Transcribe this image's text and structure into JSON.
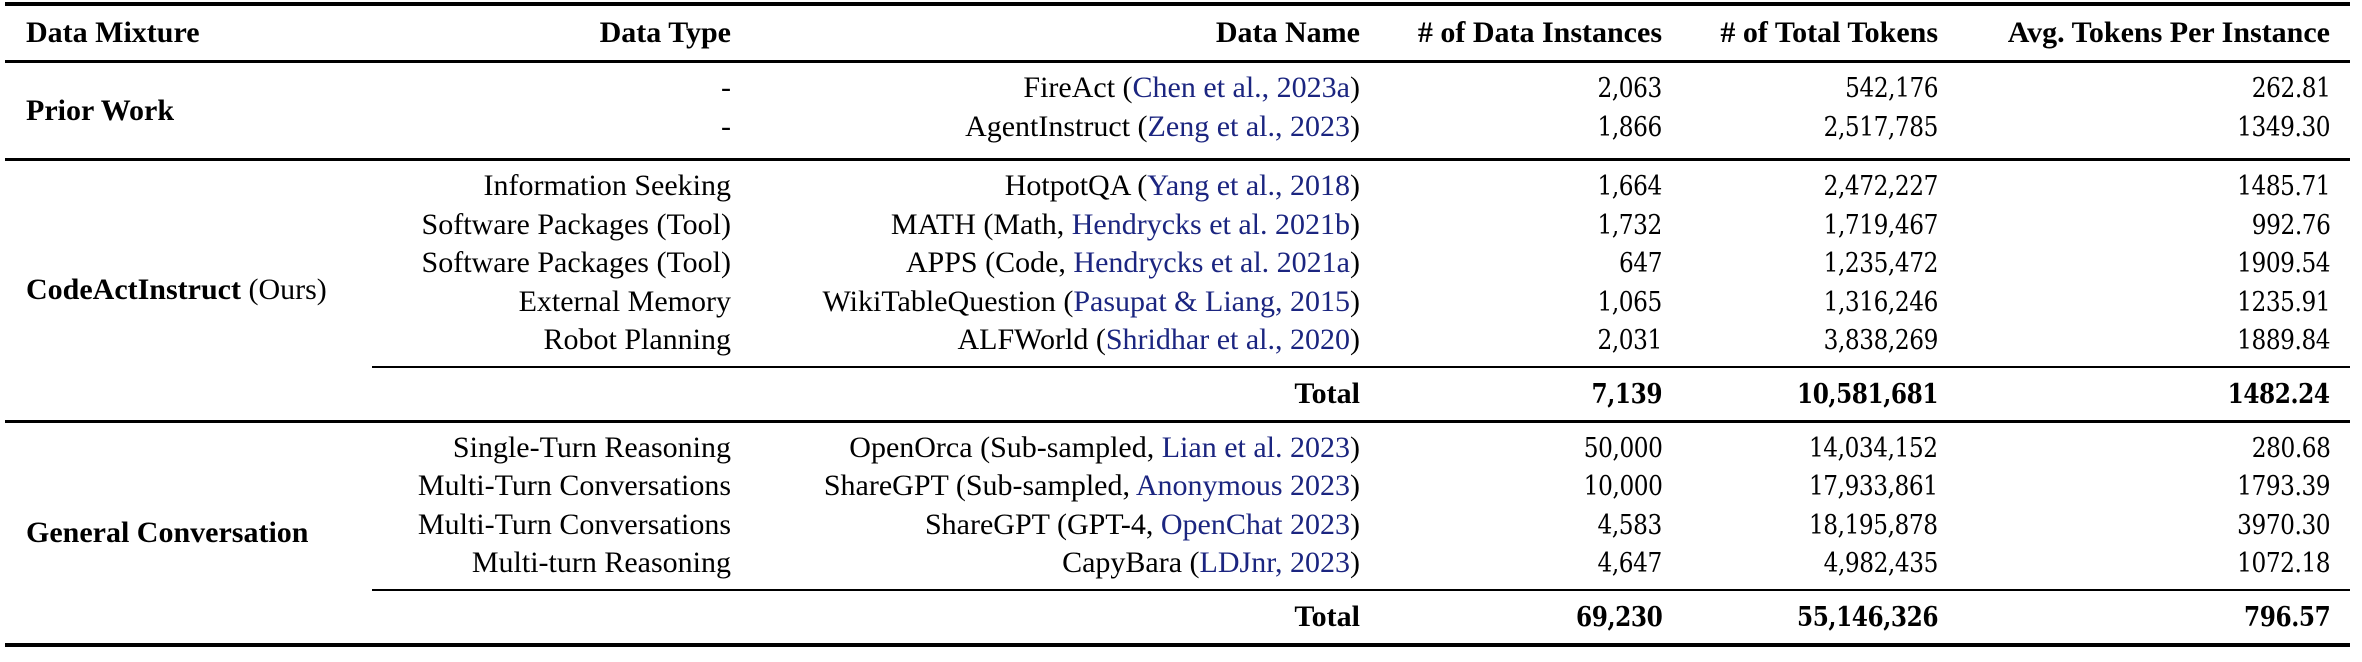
{
  "table": {
    "headers": [
      "Data Mixture",
      "Data Type",
      "Data Name",
      "# of Data Instances",
      "# of Total Tokens",
      "Avg. Tokens Per Instance"
    ],
    "sections": [
      {
        "mixture": "Prior Work",
        "mixture_suffix": "",
        "rows": [
          {
            "type": "-",
            "name": "FireAct",
            "name_extra": "",
            "cite": "Chen et al., 2023a",
            "instances": "2,063",
            "tokens": "542,176",
            "avg": "262.81"
          },
          {
            "type": "-",
            "name": "AgentInstruct",
            "name_extra": "",
            "cite": "Zeng et al., 2023",
            "instances": "1,866",
            "tokens": "2,517,785",
            "avg": "1349.30"
          }
        ],
        "total": null
      },
      {
        "mixture": "CodeActInstruct",
        "mixture_suffix": "(Ours)",
        "rows": [
          {
            "type": "Information Seeking",
            "name": "HotpotQA",
            "name_extra": "",
            "cite": "Yang et al., 2018",
            "instances": "1,664",
            "tokens": "2,472,227",
            "avg": "1485.71"
          },
          {
            "type": "Software Packages (Tool)",
            "name": "MATH",
            "name_extra": "Math, ",
            "cite": "Hendrycks et al. 2021b",
            "instances": "1,732",
            "tokens": "1,719,467",
            "avg": "992.76"
          },
          {
            "type": "Software Packages (Tool)",
            "name": "APPS",
            "name_extra": "Code, ",
            "cite": "Hendrycks et al. 2021a",
            "instances": "647",
            "tokens": "1,235,472",
            "avg": "1909.54"
          },
          {
            "type": "External Memory",
            "name": "WikiTableQuestion",
            "name_extra": "",
            "cite": "Pasupat & Liang, 2015",
            "instances": "1,065",
            "tokens": "1,316,246",
            "avg": "1235.91"
          },
          {
            "type": "Robot Planning",
            "name": "ALFWorld",
            "name_extra": "",
            "cite": "Shridhar et al., 2020",
            "instances": "2,031",
            "tokens": "3,838,269",
            "avg": "1889.84"
          }
        ],
        "total": {
          "label": "Total",
          "instances": "7,139",
          "tokens": "10,581,681",
          "avg": "1482.24"
        }
      },
      {
        "mixture": "General Conversation",
        "mixture_suffix": "",
        "rows": [
          {
            "type": "Single-Turn Reasoning",
            "name": "OpenOrca",
            "name_extra": "Sub-sampled, ",
            "cite": "Lian et al. 2023",
            "instances": "50,000",
            "tokens": "14,034,152",
            "avg": "280.68"
          },
          {
            "type": "Multi-Turn Conversations",
            "name": "ShareGPT",
            "name_extra": "Sub-sampled, ",
            "cite": "Anonymous 2023",
            "instances": "10,000",
            "tokens": "17,933,861",
            "avg": "1793.39"
          },
          {
            "type": "Multi-Turn Conversations",
            "name": "ShareGPT",
            "name_extra": "GPT-4, ",
            "cite": "OpenChat 2023",
            "instances": "4,583",
            "tokens": "18,195,878",
            "avg": "3970.30"
          },
          {
            "type": "Multi-turn Reasoning",
            "name": "CapyBara",
            "name_extra": "",
            "cite": "LDJnr, 2023",
            "instances": "4,647",
            "tokens": "4,982,435",
            "avg": "1072.18"
          }
        ],
        "total": {
          "label": "Total",
          "instances": "69,230",
          "tokens": "55,146,326",
          "avg": "796.57"
        }
      }
    ],
    "colors": {
      "citation": "#1b2580",
      "text": "#000000"
    }
  }
}
